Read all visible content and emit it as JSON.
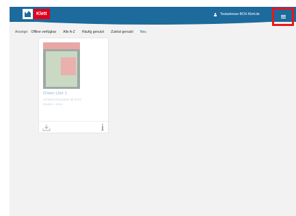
{
  "header": {
    "logo_text": "Klett",
    "user_email": "Testadresse-BOX-Klett.de",
    "menu_icon": "hamburger-menu-icon",
    "bar_color": "#1d6a9c",
    "highlight_color": "#e8161a"
  },
  "filters": {
    "label": "Anzeige:",
    "tabs": [
      "Offline verfügbar",
      "Alle A-Z",
      "Häufig genutzt",
      "Zuletzt genutzt",
      "Neu"
    ],
    "active_tab": "Neu"
  },
  "books": [
    {
      "title": "Green Line 1",
      "subtitle": "Schulbuchausgabe ab 2014",
      "extra": "Medien / Infos",
      "download_icon": "download-icon",
      "info_icon": "info-icon"
    }
  ]
}
